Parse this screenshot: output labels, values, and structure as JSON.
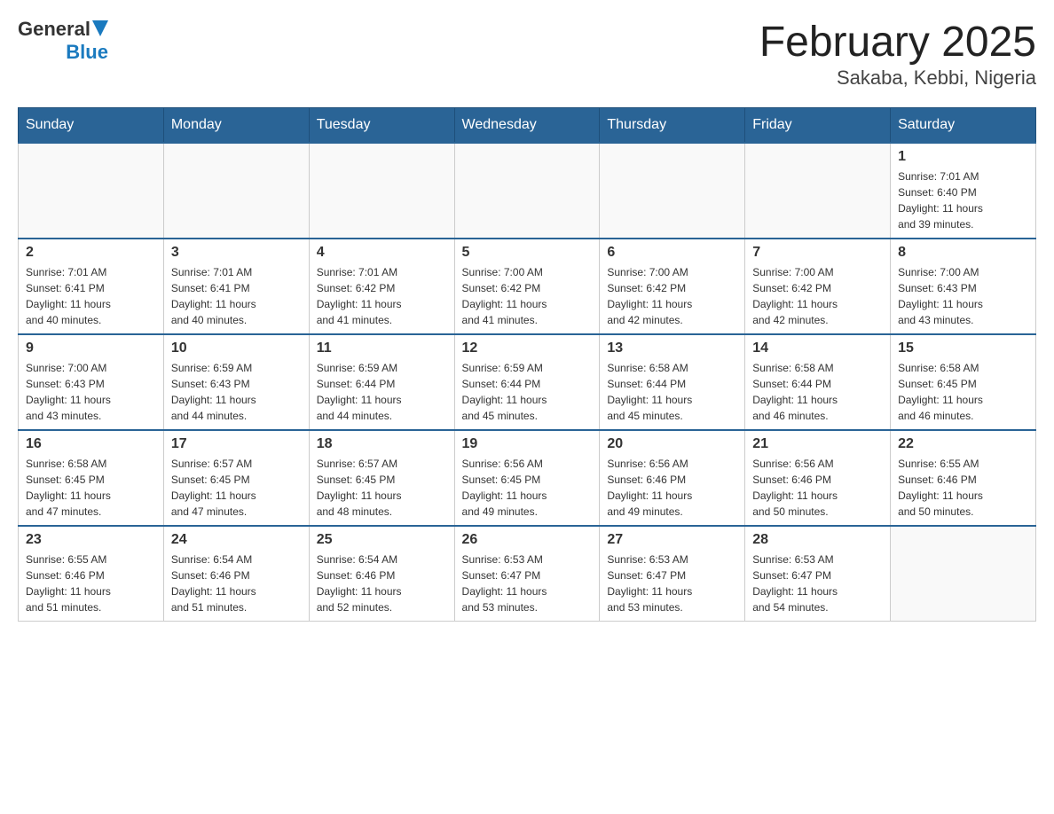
{
  "header": {
    "logo_general": "General",
    "logo_blue": "Blue",
    "title": "February 2025",
    "location": "Sakaba, Kebbi, Nigeria"
  },
  "calendar": {
    "days_of_week": [
      "Sunday",
      "Monday",
      "Tuesday",
      "Wednesday",
      "Thursday",
      "Friday",
      "Saturday"
    ],
    "weeks": [
      [
        {
          "day": "",
          "info": ""
        },
        {
          "day": "",
          "info": ""
        },
        {
          "day": "",
          "info": ""
        },
        {
          "day": "",
          "info": ""
        },
        {
          "day": "",
          "info": ""
        },
        {
          "day": "",
          "info": ""
        },
        {
          "day": "1",
          "info": "Sunrise: 7:01 AM\nSunset: 6:40 PM\nDaylight: 11 hours\nand 39 minutes."
        }
      ],
      [
        {
          "day": "2",
          "info": "Sunrise: 7:01 AM\nSunset: 6:41 PM\nDaylight: 11 hours\nand 40 minutes."
        },
        {
          "day": "3",
          "info": "Sunrise: 7:01 AM\nSunset: 6:41 PM\nDaylight: 11 hours\nand 40 minutes."
        },
        {
          "day": "4",
          "info": "Sunrise: 7:01 AM\nSunset: 6:42 PM\nDaylight: 11 hours\nand 41 minutes."
        },
        {
          "day": "5",
          "info": "Sunrise: 7:00 AM\nSunset: 6:42 PM\nDaylight: 11 hours\nand 41 minutes."
        },
        {
          "day": "6",
          "info": "Sunrise: 7:00 AM\nSunset: 6:42 PM\nDaylight: 11 hours\nand 42 minutes."
        },
        {
          "day": "7",
          "info": "Sunrise: 7:00 AM\nSunset: 6:42 PM\nDaylight: 11 hours\nand 42 minutes."
        },
        {
          "day": "8",
          "info": "Sunrise: 7:00 AM\nSunset: 6:43 PM\nDaylight: 11 hours\nand 43 minutes."
        }
      ],
      [
        {
          "day": "9",
          "info": "Sunrise: 7:00 AM\nSunset: 6:43 PM\nDaylight: 11 hours\nand 43 minutes."
        },
        {
          "day": "10",
          "info": "Sunrise: 6:59 AM\nSunset: 6:43 PM\nDaylight: 11 hours\nand 44 minutes."
        },
        {
          "day": "11",
          "info": "Sunrise: 6:59 AM\nSunset: 6:44 PM\nDaylight: 11 hours\nand 44 minutes."
        },
        {
          "day": "12",
          "info": "Sunrise: 6:59 AM\nSunset: 6:44 PM\nDaylight: 11 hours\nand 45 minutes."
        },
        {
          "day": "13",
          "info": "Sunrise: 6:58 AM\nSunset: 6:44 PM\nDaylight: 11 hours\nand 45 minutes."
        },
        {
          "day": "14",
          "info": "Sunrise: 6:58 AM\nSunset: 6:44 PM\nDaylight: 11 hours\nand 46 minutes."
        },
        {
          "day": "15",
          "info": "Sunrise: 6:58 AM\nSunset: 6:45 PM\nDaylight: 11 hours\nand 46 minutes."
        }
      ],
      [
        {
          "day": "16",
          "info": "Sunrise: 6:58 AM\nSunset: 6:45 PM\nDaylight: 11 hours\nand 47 minutes."
        },
        {
          "day": "17",
          "info": "Sunrise: 6:57 AM\nSunset: 6:45 PM\nDaylight: 11 hours\nand 47 minutes."
        },
        {
          "day": "18",
          "info": "Sunrise: 6:57 AM\nSunset: 6:45 PM\nDaylight: 11 hours\nand 48 minutes."
        },
        {
          "day": "19",
          "info": "Sunrise: 6:56 AM\nSunset: 6:45 PM\nDaylight: 11 hours\nand 49 minutes."
        },
        {
          "day": "20",
          "info": "Sunrise: 6:56 AM\nSunset: 6:46 PM\nDaylight: 11 hours\nand 49 minutes."
        },
        {
          "day": "21",
          "info": "Sunrise: 6:56 AM\nSunset: 6:46 PM\nDaylight: 11 hours\nand 50 minutes."
        },
        {
          "day": "22",
          "info": "Sunrise: 6:55 AM\nSunset: 6:46 PM\nDaylight: 11 hours\nand 50 minutes."
        }
      ],
      [
        {
          "day": "23",
          "info": "Sunrise: 6:55 AM\nSunset: 6:46 PM\nDaylight: 11 hours\nand 51 minutes."
        },
        {
          "day": "24",
          "info": "Sunrise: 6:54 AM\nSunset: 6:46 PM\nDaylight: 11 hours\nand 51 minutes."
        },
        {
          "day": "25",
          "info": "Sunrise: 6:54 AM\nSunset: 6:46 PM\nDaylight: 11 hours\nand 52 minutes."
        },
        {
          "day": "26",
          "info": "Sunrise: 6:53 AM\nSunset: 6:47 PM\nDaylight: 11 hours\nand 53 minutes."
        },
        {
          "day": "27",
          "info": "Sunrise: 6:53 AM\nSunset: 6:47 PM\nDaylight: 11 hours\nand 53 minutes."
        },
        {
          "day": "28",
          "info": "Sunrise: 6:53 AM\nSunset: 6:47 PM\nDaylight: 11 hours\nand 54 minutes."
        },
        {
          "day": "",
          "info": ""
        }
      ]
    ]
  }
}
